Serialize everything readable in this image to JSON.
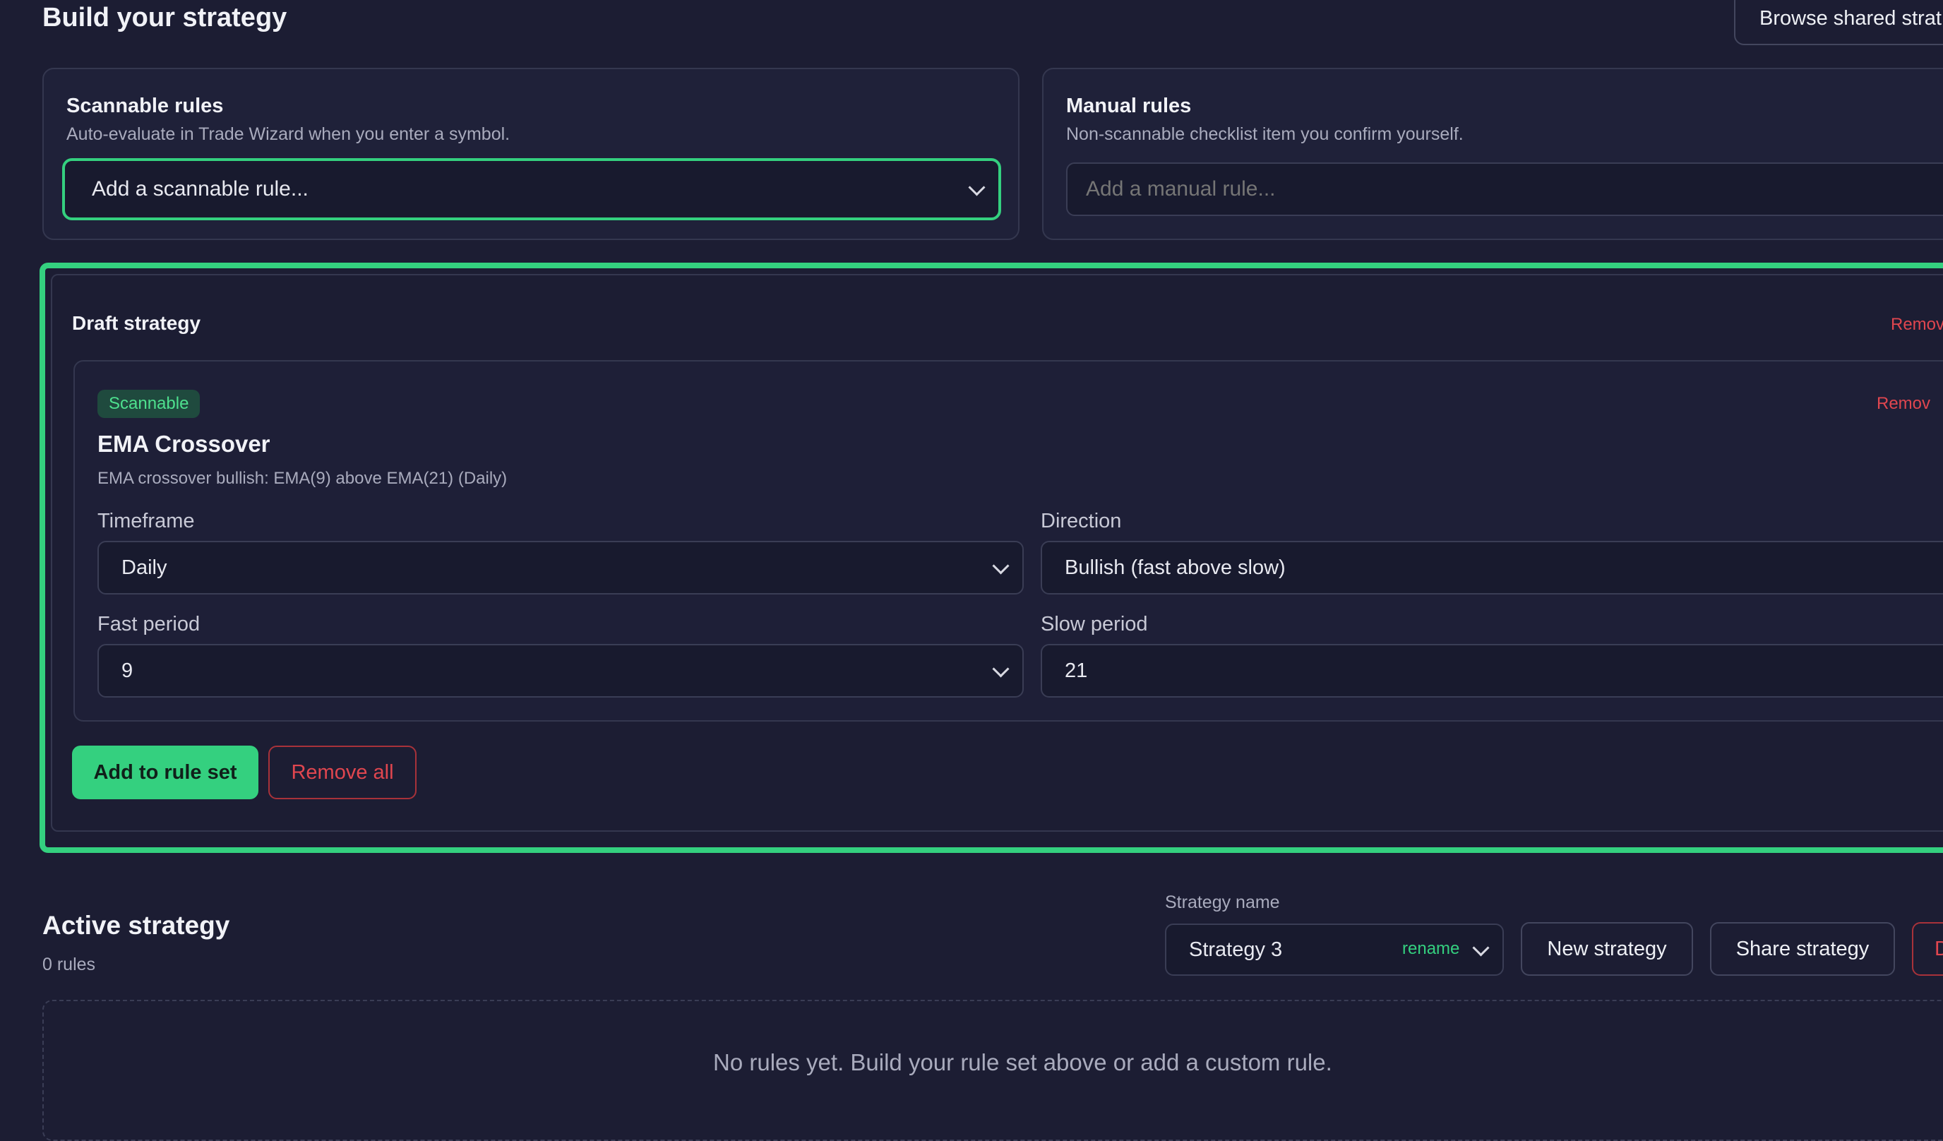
{
  "header": {
    "title": "Build your strategy",
    "browse_button": "Browse shared strat"
  },
  "scannable": {
    "title": "Scannable rules",
    "subtitle": "Auto-evaluate in Trade Wizard when you enter a symbol.",
    "select_value": "Add a scannable rule..."
  },
  "manual": {
    "title": "Manual rules",
    "subtitle": "Non-scannable checklist item you confirm yourself.",
    "placeholder": "Add a manual rule..."
  },
  "draft": {
    "title": "Draft strategy",
    "remove_label": "Remov",
    "rule": {
      "badge": "Scannable",
      "name": "EMA Crossover",
      "description": "EMA crossover bullish: EMA(9) above EMA(21) (Daily)",
      "remove_label": "Remov",
      "fields": {
        "timeframe_label": "Timeframe",
        "timeframe_value": "Daily",
        "direction_label": "Direction",
        "direction_value": "Bullish (fast above slow)",
        "fast_label": "Fast period",
        "fast_value": "9",
        "slow_label": "Slow period",
        "slow_value": "21"
      }
    },
    "add_button": "Add to rule set",
    "remove_all_button": "Remove all"
  },
  "active": {
    "title": "Active strategy",
    "count": "0 rules",
    "name_label": "Strategy name",
    "name_value": "Strategy 3",
    "rename_label": "rename",
    "new_button": "New strategy",
    "share_button": "Share strategy",
    "delete_button_fragment": "D",
    "empty_message": "No rules yet. Build your rule set above or add a custom rule."
  },
  "colors": {
    "accent": "#34d07f",
    "danger": "#e0464f",
    "background": "#1c1d33"
  }
}
